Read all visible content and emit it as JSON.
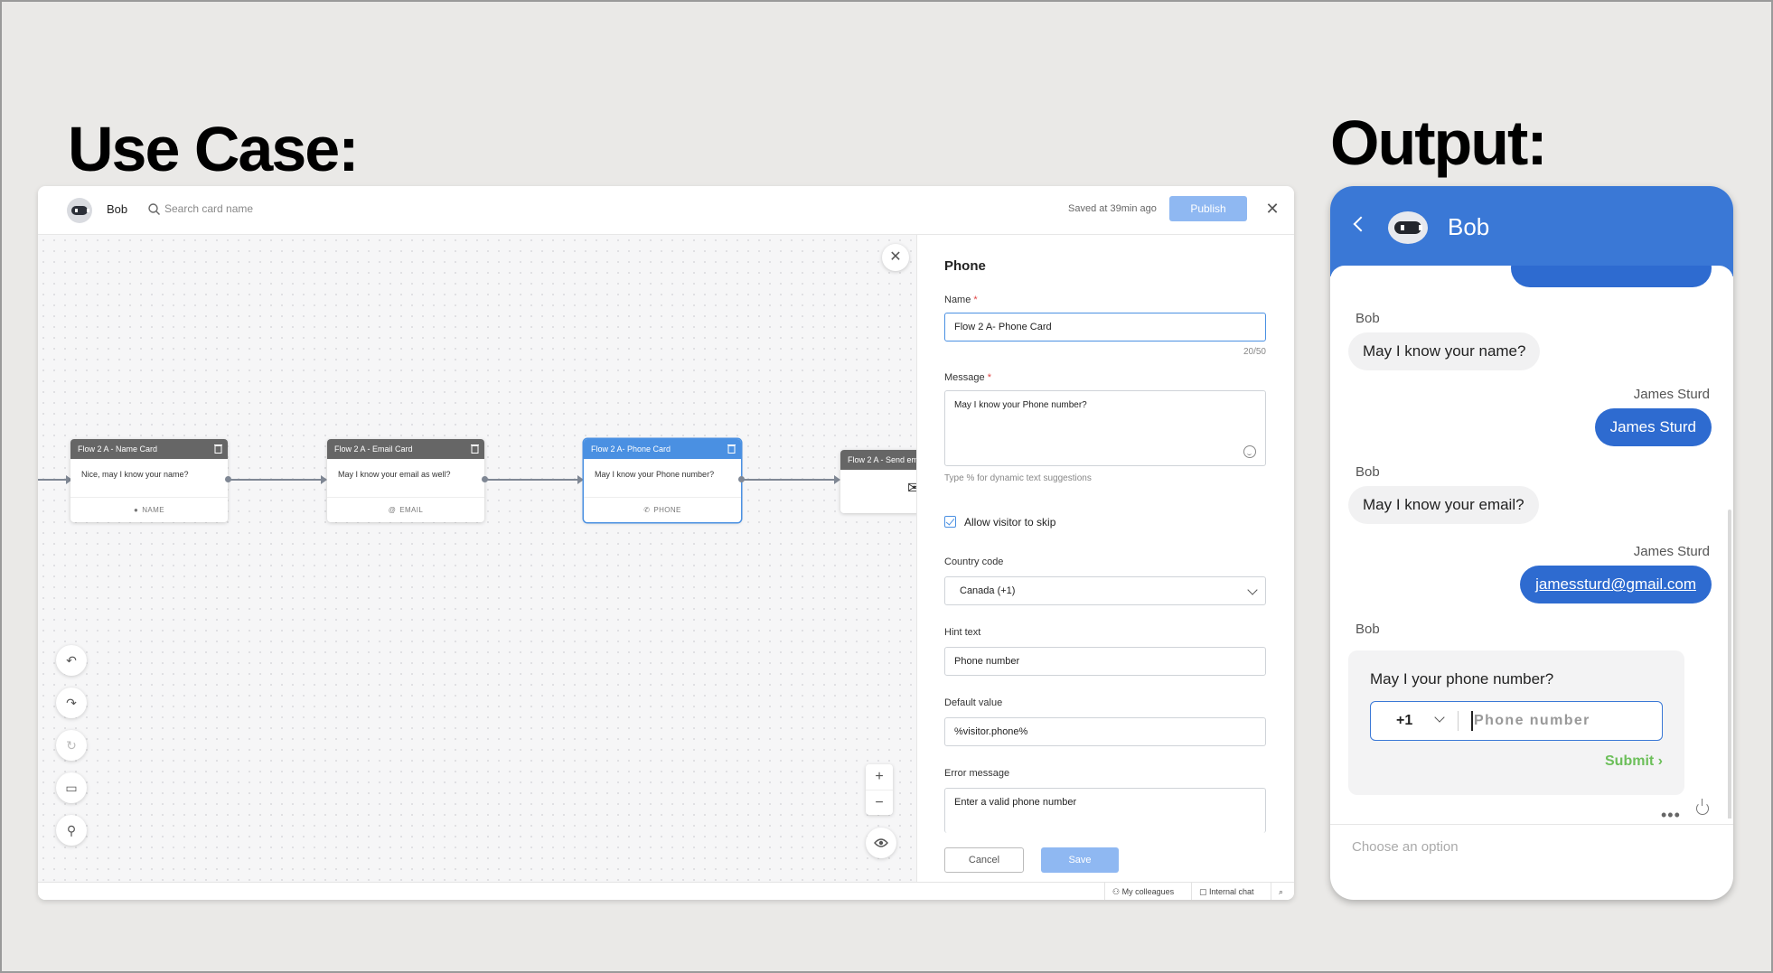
{
  "headings": {
    "left": "Use Case:",
    "right": "Output:"
  },
  "builder": {
    "bot_name": "Bob",
    "search_placeholder": "Search card name",
    "saved_text": "Saved at 39min ago",
    "publish_label": "Publish",
    "nodes": [
      {
        "title": "Flow 2 A - Name Card",
        "message": "Nice, may I know your name?",
        "type": "NAME",
        "icon": "person-icon"
      },
      {
        "title": "Flow 2 A - Email Card",
        "message": "May I know your email as well?",
        "type": "EMAIL",
        "icon": "at-icon"
      },
      {
        "title": "Flow 2 A- Phone Card",
        "message": "May I know your Phone number?",
        "type": "PHONE",
        "icon": "phone-icon"
      },
      {
        "title": "Flow 2 A - Send em"
      }
    ],
    "panel": {
      "title": "Phone",
      "name_label": "Name",
      "name_value": "Flow 2 A- Phone Card",
      "name_counter": "20/50",
      "message_label": "Message",
      "message_value": "May I know your Phone number?",
      "message_hint": "Type % for dynamic text suggestions",
      "skip_label": "Allow visitor to skip",
      "country_label": "Country code",
      "country_value": "Canada (+1)",
      "hint_label": "Hint text",
      "hint_value": "Phone number",
      "default_label": "Default value",
      "default_value": "%visitor.phone%",
      "error_label": "Error message",
      "error_value": "Enter a valid phone number",
      "cancel_label": "Cancel",
      "save_label": "Save"
    },
    "statusbar": {
      "colleagues": "My colleagues",
      "internal_chat": "Internal chat"
    },
    "accent": "#4a90e2"
  },
  "chat": {
    "bot_name": "Bob",
    "messages": [
      {
        "sender": "Bob",
        "text": "May I know your name?"
      },
      {
        "sender": "James Sturd",
        "text": "James Sturd"
      },
      {
        "sender": "Bob",
        "text": "May I know your email?"
      },
      {
        "sender": "James Sturd",
        "text": "jamessturd@gmail.com"
      },
      {
        "sender": "Bob"
      }
    ],
    "phone_card": {
      "question": "May I your phone number?",
      "country_code": "+1",
      "placeholder": "Phone number",
      "submit_label": "Submit"
    },
    "footer_placeholder": "Choose an option",
    "header_color": "#3a78d6",
    "submit_color": "#6cbf5a"
  }
}
